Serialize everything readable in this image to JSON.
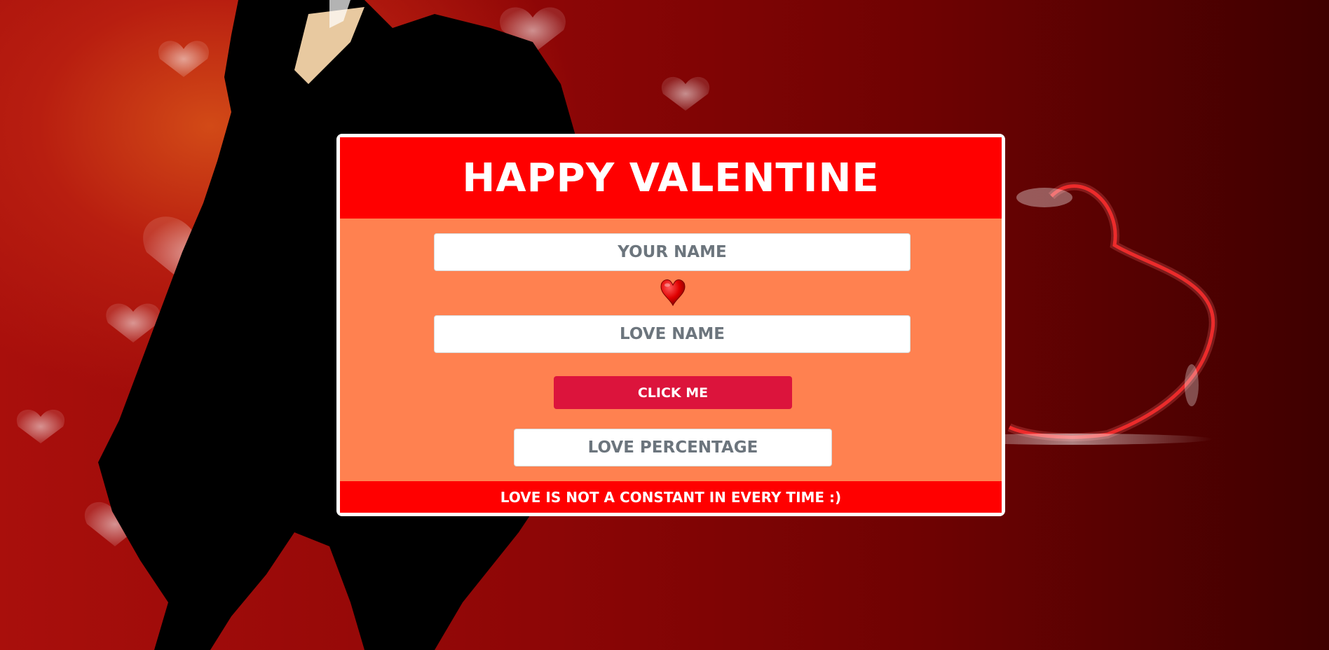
{
  "header": {
    "title": "HAPPY VALENTINE"
  },
  "form": {
    "your_name_placeholder": "YOUR NAME",
    "heart_icon": "heart-icon",
    "love_name_placeholder": "LOVE NAME",
    "button_label": "CLICK ME",
    "percentage_placeholder": "LOVE PERCENTAGE"
  },
  "footer": {
    "text": "LOVE IS NOT A CONSTANT IN EVERY TIME :)"
  },
  "colors": {
    "header_bg": "#ff0000",
    "body_bg": "#ff8150",
    "button_bg": "#dc143c",
    "placeholder": "#6c757d",
    "text_light": "#ffffff"
  }
}
